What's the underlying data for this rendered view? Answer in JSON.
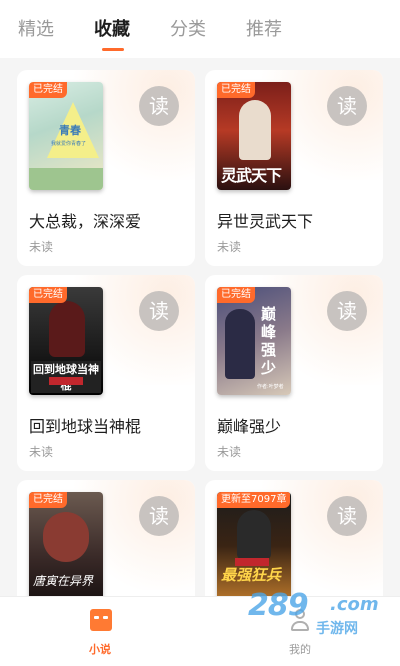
{
  "tabs": [
    {
      "label": "精选",
      "active": false
    },
    {
      "label": "收藏",
      "active": true
    },
    {
      "label": "分类",
      "active": false
    },
    {
      "label": "推荐",
      "active": false
    }
  ],
  "read_label": "读",
  "books": [
    {
      "title": "大总裁，深深爱",
      "status": "未读",
      "badge": "已完结",
      "cover_text": "青春",
      "cover_sub": "我就爱你青春了"
    },
    {
      "title": "异世灵武天下",
      "status": "未读",
      "badge": "已完结",
      "cover_text": "灵武天下"
    },
    {
      "title": "回到地球当神棍",
      "status": "未读",
      "badge": "已完结",
      "cover_text": "回到地球当神棍"
    },
    {
      "title": "巅峰强少",
      "status": "未读",
      "badge": "已完结",
      "cover_text": "巅峰强少",
      "cover_sub": "作者:叶梦者"
    },
    {
      "title": "唐寅在异界",
      "status": "",
      "badge": "已完结",
      "cover_text": "唐寅在异界"
    },
    {
      "title": "最强狂兵",
      "status": "",
      "badge": "更新至7097章",
      "cover_text": "最强狂兵"
    }
  ],
  "bottom_nav": [
    {
      "label": "小说",
      "icon": "book-icon",
      "active": true
    },
    {
      "label": "我的",
      "icon": "person-icon",
      "active": false
    }
  ],
  "watermark": {
    "num": "289",
    "com": ".com",
    "cn": "手游网"
  },
  "colors": {
    "accent": "#ff6a2b",
    "read_button": "#c8c3c0",
    "background": "#f5f5f5"
  }
}
